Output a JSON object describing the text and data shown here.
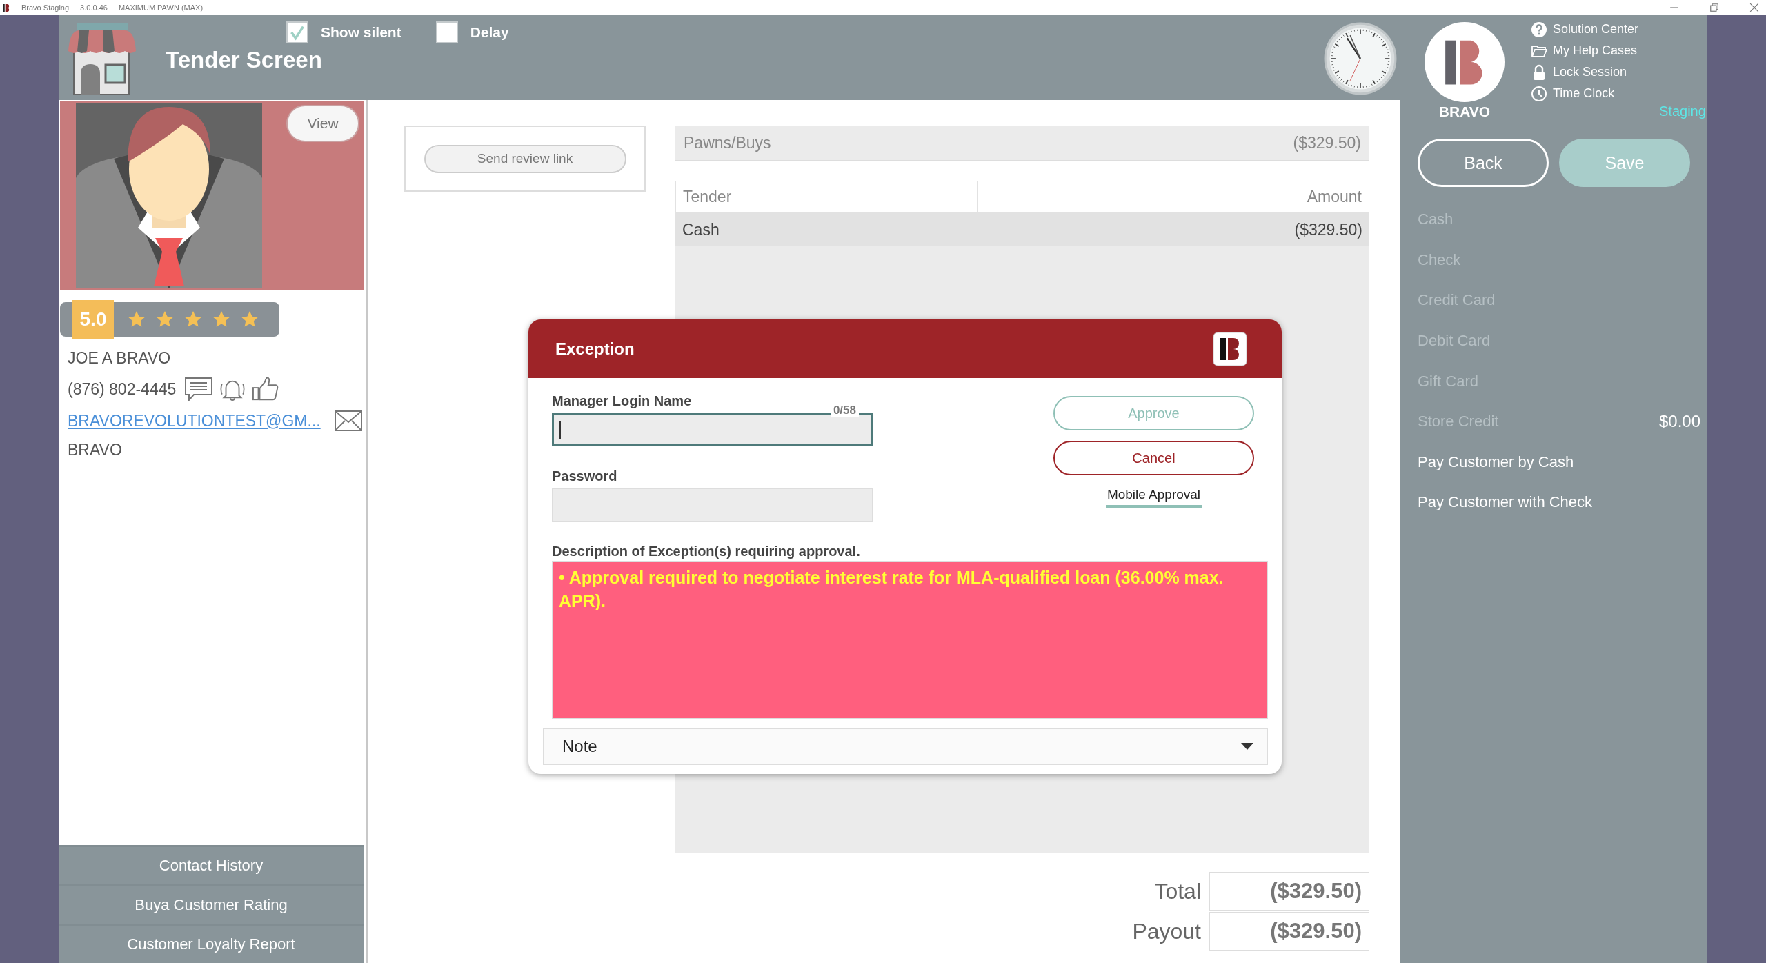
{
  "title_bar": {
    "app": "Bravo Staging",
    "version": "3.0.0.46",
    "store": "MAXIMUM PAWN (MAX)"
  },
  "header": {
    "title": "Tender Screen",
    "options": [
      {
        "label": "Show silent",
        "checked": true
      },
      {
        "label": "Delay",
        "checked": false
      }
    ],
    "brand": "BRAVO",
    "links": [
      {
        "label": "Solution Center"
      },
      {
        "label": "My Help Cases"
      },
      {
        "label": "Lock Session"
      },
      {
        "label": "Time Clock"
      }
    ],
    "environment": "Staging"
  },
  "customer": {
    "view_button": "View",
    "rating": "5.0",
    "stars": 5,
    "name": "JOE A BRAVO",
    "phone": "(876) 802-4445",
    "email": "BRAVOREVOLUTIONTEST@GM...",
    "group": "BRAVO",
    "actions": [
      "Contact History",
      "Buya Customer Rating",
      "Customer Loyalty Report"
    ]
  },
  "review": {
    "button": "Send review link"
  },
  "summary": {
    "label": "Pawns/Buys",
    "amount": "($329.50)"
  },
  "tender_table": {
    "columns": [
      "Tender",
      "Amount"
    ],
    "rows": [
      {
        "tender": "Cash",
        "amount": "($329.50)"
      }
    ]
  },
  "totals": [
    {
      "label": "Total",
      "value": "($329.50)"
    },
    {
      "label": "Payout",
      "value": "($329.50)"
    }
  ],
  "buttons": {
    "back": "Back",
    "save": "Save"
  },
  "tender_options": [
    {
      "label": "Cash",
      "disabled": true
    },
    {
      "label": "Check",
      "disabled": true
    },
    {
      "label": "Credit Card",
      "disabled": true
    },
    {
      "label": "Debit Card",
      "disabled": true
    },
    {
      "label": "Gift Card",
      "disabled": true
    },
    {
      "label": "Store Credit",
      "disabled": true,
      "balance": "$0.00"
    },
    {
      "label": "Pay Customer by Cash",
      "disabled": false
    },
    {
      "label": "Pay Customer with Check",
      "disabled": false
    }
  ],
  "dialog": {
    "title": "Exception",
    "fields": [
      {
        "label": "Manager Login Name",
        "counter": "0/58",
        "focused": true
      },
      {
        "label": "Password",
        "focused": false
      }
    ],
    "approve": "Approve",
    "cancel": "Cancel",
    "mobile_approval": "Mobile Approval",
    "description_label": "Description of Exception(s) requiring approval.",
    "exceptions": [
      "• Approval required to negotiate interest rate for MLA-qualified loan (36.00% max. APR)."
    ],
    "note": "Note"
  }
}
